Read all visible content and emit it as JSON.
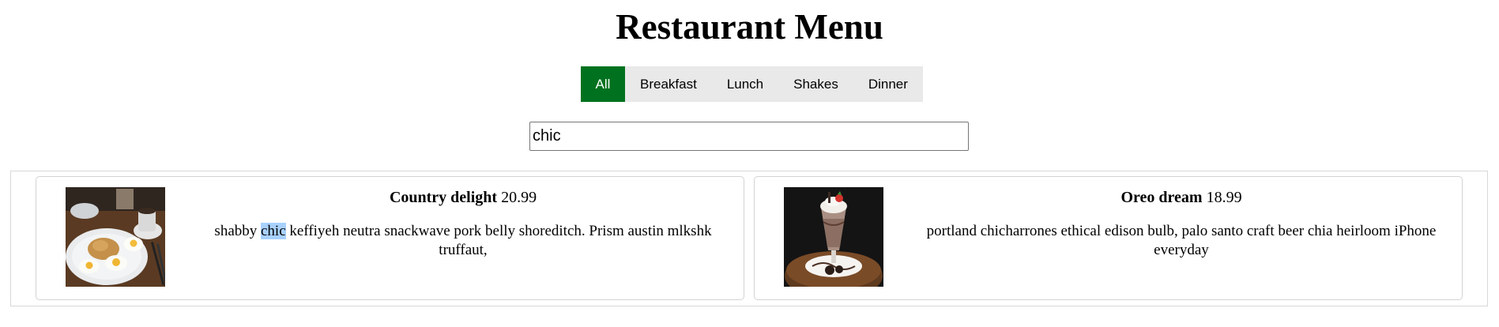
{
  "page": {
    "title": "Restaurant Menu"
  },
  "filters": [
    {
      "label": "All",
      "active": true
    },
    {
      "label": "Breakfast",
      "active": false
    },
    {
      "label": "Lunch",
      "active": false
    },
    {
      "label": "Shakes",
      "active": false
    },
    {
      "label": "Dinner",
      "active": false
    }
  ],
  "search": {
    "value": "chic"
  },
  "items": [
    {
      "name": "Country delight",
      "price": "20.99",
      "desc_before": "shabby ",
      "desc_highlight": "chic",
      "desc_after": " keffiyeh neutra snackwave pork belly shoreditch. Prism austin mlkshk truffaut,"
    },
    {
      "name": "Oreo dream",
      "price": "18.99",
      "desc_before": "portland chicharrones ethical edison bulb, palo santo craft beer chia heirloom iPhone everyday",
      "desc_highlight": "",
      "desc_after": ""
    }
  ],
  "colors": {
    "active_filter": "#00721f",
    "filter_bg": "#e9e9e9",
    "highlight": "#a8d1ff"
  }
}
